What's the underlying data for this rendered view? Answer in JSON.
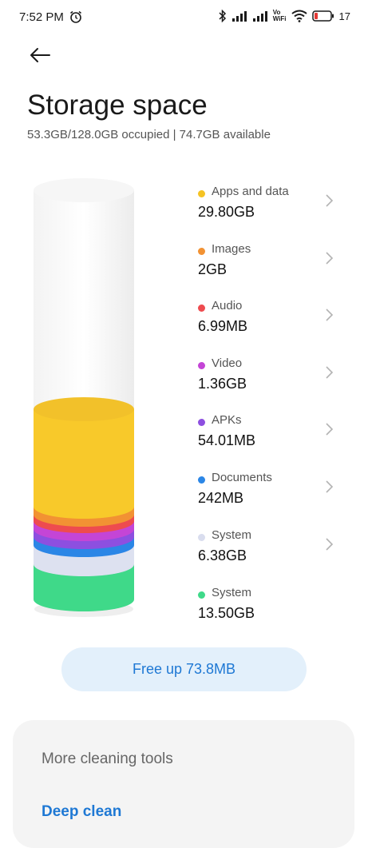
{
  "status_bar": {
    "time": "7:52 PM",
    "net1": "Vo",
    "net2": "WiFi",
    "battery": "17"
  },
  "header": {
    "title": "Storage space",
    "summary": "53.3GB/128.0GB occupied | 74.7GB available"
  },
  "categories": [
    {
      "name": "Apps and data",
      "size": "29.80GB",
      "color": "#f5c323"
    },
    {
      "name": "Images",
      "size": "2GB",
      "color": "#f29233"
    },
    {
      "name": "Audio",
      "size": "6.99MB",
      "color": "#ee4b4f"
    },
    {
      "name": "Video",
      "size": "1.36GB",
      "color": "#c445d6"
    },
    {
      "name": "APKs",
      "size": "54.01MB",
      "color": "#8d4fe0"
    },
    {
      "name": "Documents",
      "size": "242MB",
      "color": "#2b86e6"
    },
    {
      "name": "System",
      "size": "6.38GB",
      "color": "#d9ddee"
    },
    {
      "name": "System",
      "size": "13.50GB",
      "color": "#3fd989"
    }
  ],
  "actions": {
    "free_up": "Free up 73.8MB"
  },
  "tools": {
    "title": "More cleaning tools",
    "deep_clean": "Deep clean"
  },
  "colors": {
    "accent": "#1e78d4",
    "free_button_bg": "#e3f0fb"
  }
}
